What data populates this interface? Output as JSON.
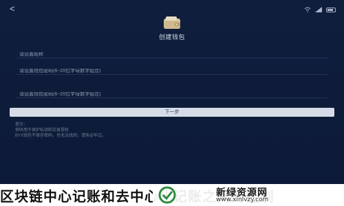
{
  "header": {
    "back_glyph": "<",
    "title": "创建钱包"
  },
  "form": {
    "wallet_name_placeholder": "请设置昵称",
    "password_placeholder": "请设置钱包密码(6~20位字母数字组合)",
    "confirm_password_placeholder": "请设置钱包密码(6~20位字母数字组合)",
    "next_label": "下一步"
  },
  "notice": {
    "heading": "提示：",
    "line1": "密码用于保护私钥和交易授权",
    "line2": "BYX钱包不保存密码，也无法找回，请务必牢记。"
  },
  "watermark": {
    "caption": "区块链中心记账和去中心化记账之间的区别",
    "logo_title": "新绿资源网",
    "logo_url": "www.xinlvzy.com"
  },
  "colors": {
    "background": "#0f1e3d",
    "button": "#d5dce8",
    "text_muted": "#8e9ab3"
  }
}
